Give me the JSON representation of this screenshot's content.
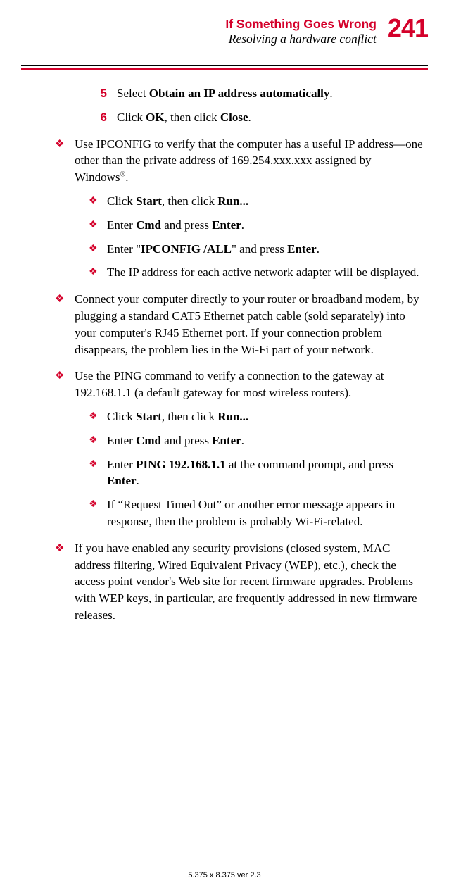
{
  "header": {
    "title": "If Something Goes Wrong",
    "subtitle": "Resolving a hardware conflict",
    "page_number": "241"
  },
  "steps": {
    "num5": "5",
    "step5_a": "Select ",
    "step5_b": "Obtain an IP address automatically",
    "step5_c": ".",
    "num6": "6",
    "step6_a": "Click ",
    "step6_b": "OK",
    "step6_c": ", then click ",
    "step6_d": "Close",
    "step6_e": "."
  },
  "b1": {
    "t1": "Use IPCONFIG to verify that the computer has a useful IP address—one other than the private address of 169.254.xxx.xxx assigned by Windows",
    "sup": "®",
    "t2": ".",
    "s1a": "Click ",
    "s1b": "Start",
    "s1c": ", then click ",
    "s1d": "Run...",
    "s2a": "Enter ",
    "s2b": "Cmd",
    "s2c": " and press ",
    "s2d": "Enter",
    "s2e": ".",
    "s3a": "Enter \"",
    "s3b": "IPCONFIG /ALL",
    "s3c": "\" and press ",
    "s3d": "Enter",
    "s3e": ".",
    "s4": "The IP address for each active network adapter will be displayed."
  },
  "b2": {
    "t1": "Connect your computer directly to your router or broadband modem, by plugging a standard CAT5 Ethernet patch cable (sold separately) into your computer's RJ45 Ethernet port. If your connection problem disappears, the problem lies in the Wi-Fi part of your network."
  },
  "b3": {
    "t1": "Use the PING command to verify a connection to the gateway at 192.168.1.1 (a default gateway for most wireless routers).",
    "s1a": "Click ",
    "s1b": "Start",
    "s1c": ", then click ",
    "s1d": "Run...",
    "s2a": "Enter ",
    "s2b": "Cmd",
    "s2c": " and press ",
    "s2d": "Enter",
    "s2e": ".",
    "s3a": "Enter ",
    "s3b": "PING 192.168.1.1",
    "s3c": " at the command prompt, and press ",
    "s3d": "Enter",
    "s3e": ".",
    "s4": "If “Request Timed Out” or another error message appears in response, then the problem is probably Wi-Fi-related."
  },
  "b4": {
    "t1": "If you have enabled any security provisions (closed system, MAC address filtering, Wired Equivalent Privacy (WEP), etc.), check the access point vendor's Web site for recent firmware upgrades. Problems with WEP keys, in particular, are frequently addressed in new firmware releases."
  },
  "footer": "5.375 x 8.375 ver 2.3"
}
